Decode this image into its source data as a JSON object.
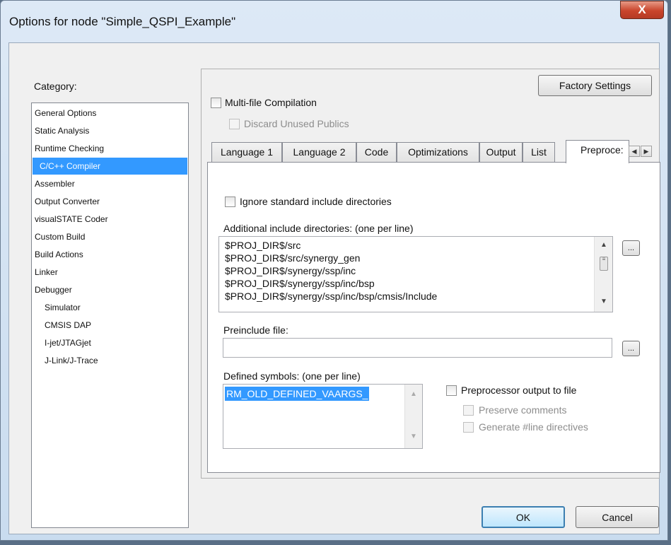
{
  "window": {
    "title": "Options for node \"Simple_QSPI_Example\"",
    "close_glyph": "X"
  },
  "category": {
    "label": "Category:",
    "items": [
      "General Options",
      "Static Analysis",
      "Runtime Checking",
      "C/C++ Compiler",
      "Assembler",
      "Output Converter",
      "visualSTATE Coder",
      "Custom Build",
      "Build Actions",
      "Linker",
      "Debugger",
      "Simulator",
      "CMSIS DAP",
      "I-jet/JTAGjet",
      "J-Link/J-Trace"
    ],
    "selected": "C/C++ Compiler"
  },
  "factory_settings_label": "Factory Settings",
  "multi_file": {
    "label": "Multi-file Compilation",
    "checked": false
  },
  "discard_unused": {
    "label": "Discard Unused Publics",
    "checked": false,
    "disabled": true
  },
  "tabs": [
    "Language 1",
    "Language 2",
    "Code",
    "Optimizations",
    "Output",
    "List",
    "Preproce:"
  ],
  "active_tab": "Preproce:",
  "preprocessor": {
    "ignore_std_label": "Ignore standard include directories",
    "include_dirs_label": "Additional include directories: (one per line)",
    "include_dirs": [
      "$PROJ_DIR$/src",
      "$PROJ_DIR$/src/synergy_gen",
      "$PROJ_DIR$/synergy/ssp/inc",
      "$PROJ_DIR$/synergy/ssp/inc/bsp",
      "$PROJ_DIR$/synergy/ssp/inc/bsp/cmsis/Include"
    ],
    "browse_label": "...",
    "preinclude_label": "Preinclude file:",
    "preinclude_value": "",
    "defined_label": "Defined symbols: (one per line)",
    "defined_symbols": [
      "RM_OLD_DEFINED_VAARGS_"
    ],
    "output_to_file_label": "Preprocessor output to file",
    "preserve_comments_label": "Preserve comments",
    "generate_line_label": "Generate #line directives"
  },
  "ok_label": "OK",
  "cancel_label": "Cancel"
}
